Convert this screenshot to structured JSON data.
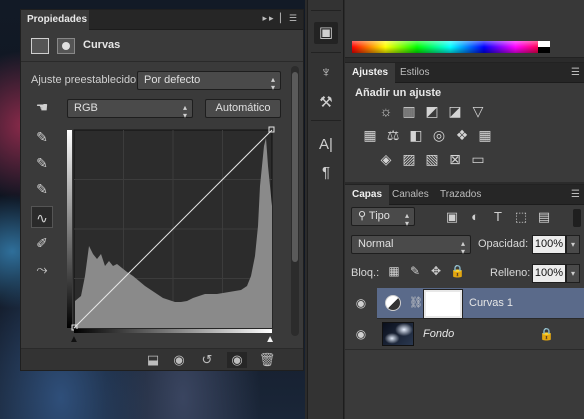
{
  "properties_panel": {
    "tab_title": "Propiedades",
    "panel_title": "Curvas",
    "preset_label": "Ajuste preestablecido:",
    "preset_value": "Por defecto",
    "channel_value": "RGB",
    "auto_button": "Automático"
  },
  "right_panels": {
    "adjustments_tabs": [
      "Ajustes",
      "Estilos"
    ],
    "adjustments_title": "Añadir un ajuste",
    "layers_tabs": [
      "Capas",
      "Canales",
      "Trazados"
    ],
    "filter_kind": "Tipo",
    "blend_mode": "Normal",
    "opacity_label": "Opacidad:",
    "opacity_value": "100%",
    "lock_label": "Bloq.:",
    "fill_label": "Relleno:",
    "fill_value": "100%",
    "layers": [
      {
        "name": "Curvas 1"
      },
      {
        "name": "Fondo"
      }
    ]
  },
  "icons": {
    "dock": [
      "layers-3d-icon",
      "brush-preset-icon",
      "clone-source-icon",
      "character-icon",
      "paragraph-icon"
    ],
    "curve_tools": [
      "target-adjust-icon",
      "black-eyedropper-icon",
      "gray-eyedropper-icon",
      "white-eyedropper-icon",
      "curve-edit-icon",
      "pencil-icon",
      "smooth-icon"
    ]
  },
  "colors": {
    "panel_bg": "#3a3a3a",
    "selected_layer": "#5a6a8a"
  }
}
